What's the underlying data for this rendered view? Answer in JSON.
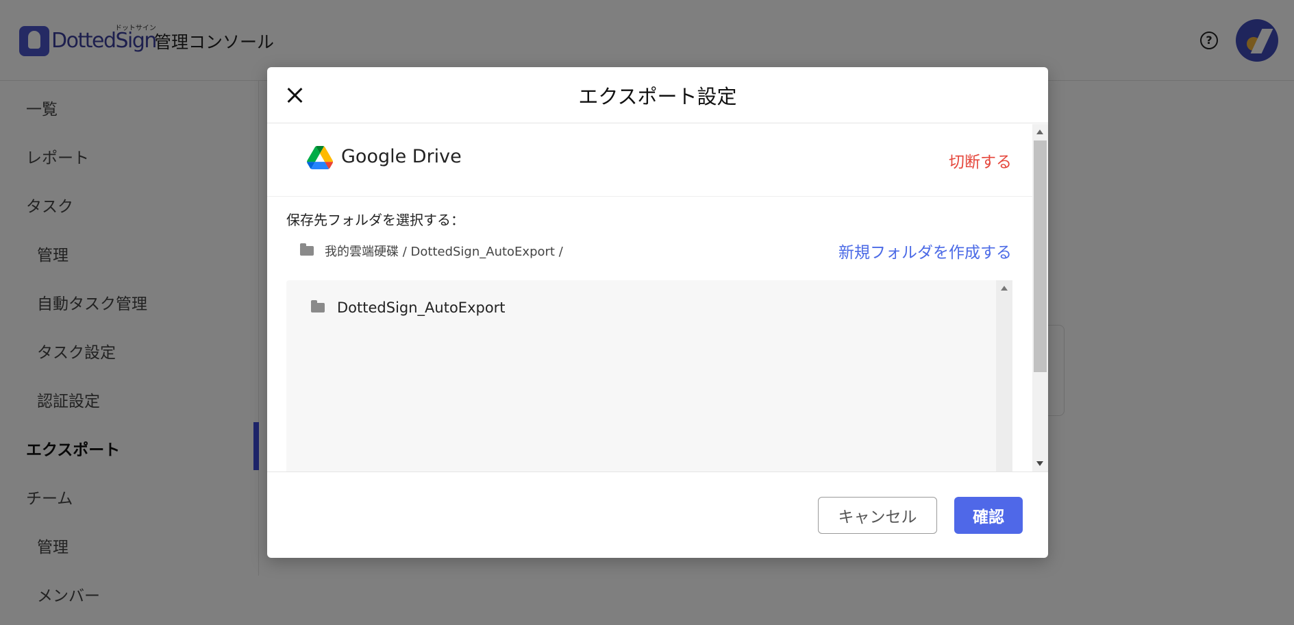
{
  "app": {
    "logo_text": "DottedSign",
    "logo_kana": "ドットサイン",
    "console_title": "管理コンソール",
    "help_icon_glyph": "?"
  },
  "sidebar": {
    "items": [
      {
        "label": "一覧",
        "level": "top"
      },
      {
        "label": "レポート",
        "level": "top"
      },
      {
        "label": "タスク",
        "level": "top"
      },
      {
        "label": "管理",
        "level": "sub"
      },
      {
        "label": "自動タスク管理",
        "level": "sub"
      },
      {
        "label": "タスク設定",
        "level": "sub"
      },
      {
        "label": "認証設定",
        "level": "sub"
      },
      {
        "label": "エクスポート",
        "level": "top",
        "active": true
      },
      {
        "label": "チーム",
        "level": "top"
      },
      {
        "label": "管理",
        "level": "sub"
      },
      {
        "label": "メンバー",
        "level": "sub"
      }
    ]
  },
  "modal": {
    "title": "エクスポート設定",
    "provider": {
      "name": "Google Drive",
      "icon": "google-drive-icon",
      "disconnect_label": "切断する"
    },
    "folder_select_label": "保存先フォルダを選択する：",
    "current_path": "我的雲端硬碟 / DottedSign_AutoExport /",
    "new_folder_label": "新規フォルダを作成する",
    "folders": [
      {
        "name": "DottedSign_AutoExport"
      }
    ],
    "footer": {
      "cancel_label": "キャンセル",
      "confirm_label": "確認"
    }
  },
  "colors": {
    "brand": "#3c4bd6",
    "primary_button": "#4f68e8",
    "link_blue": "#4b6ae6",
    "danger": "#e5473c",
    "overlay": "rgba(0,0,0,0.5)"
  }
}
